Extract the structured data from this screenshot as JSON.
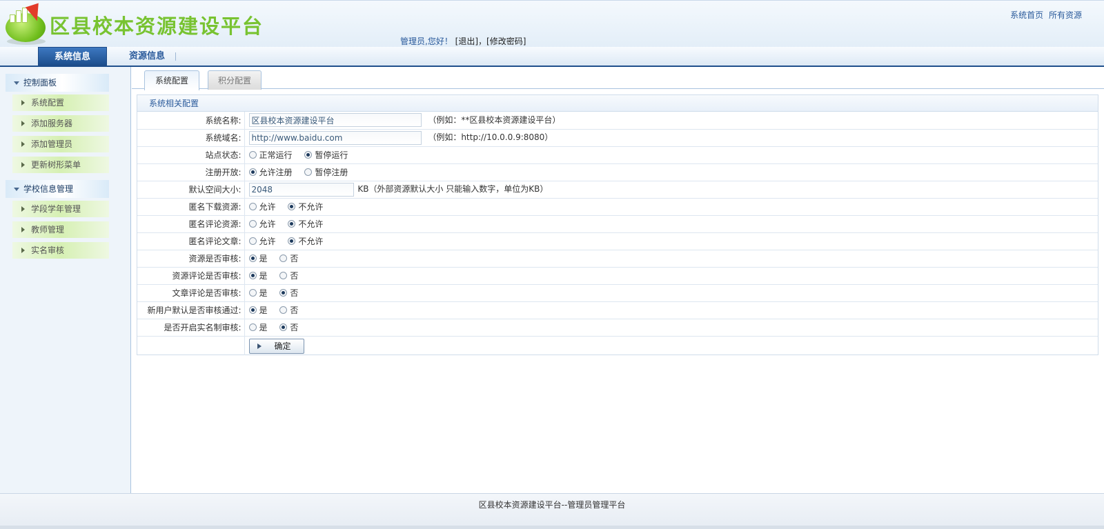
{
  "header": {
    "site_title": "区县校本资源建设平台",
    "welcome_prefix": "管理员,您好！",
    "logout": "[退出]",
    "separator": "，",
    "change_password": "[修改密码]",
    "top_links": [
      "系统首页",
      "所有资源"
    ]
  },
  "nav": {
    "tabs": [
      {
        "label": "系统信息",
        "active": true
      },
      {
        "label": "资源信息",
        "active": false
      }
    ]
  },
  "sidebar": {
    "groups": [
      {
        "title": "控制面板",
        "items": [
          "系统配置",
          "添加服务器",
          "添加管理员",
          "更新树形菜单"
        ]
      },
      {
        "title": "学校信息管理",
        "items": [
          "学段学年管理",
          "教师管理",
          "实名审核"
        ]
      }
    ]
  },
  "main": {
    "tabs": [
      {
        "label": "系统配置",
        "active": true
      },
      {
        "label": "积分配置",
        "active": false
      }
    ],
    "panel_title": "系统相关配置",
    "fields": {
      "system_name": {
        "label": "系统名称:",
        "value": "区县校本资源建设平台",
        "hint": "（例如：**区县校本资源建设平台）"
      },
      "system_domain": {
        "label": "系统域名:",
        "value": "http://www.baidu.com",
        "hint": "（例如：http://10.0.0.9:8080）"
      },
      "site_status": {
        "label": "站点状态:",
        "options": [
          "正常运行",
          "暂停运行"
        ],
        "selected": 1
      },
      "registration": {
        "label": "注册开放:",
        "options": [
          "允许注册",
          "暂停注册"
        ],
        "selected": 0
      },
      "default_space": {
        "label": "默认空间大小:",
        "value": "2048",
        "hint": "KB（外部资源默认大小 只能输入数字，单位为KB）"
      },
      "anon_download": {
        "label": "匿名下载资源:",
        "options": [
          "允许",
          "不允许"
        ],
        "selected": 1
      },
      "anon_comment_resource": {
        "label": "匿名评论资源:",
        "options": [
          "允许",
          "不允许"
        ],
        "selected": 1
      },
      "anon_comment_article": {
        "label": "匿名评论文章:",
        "options": [
          "允许",
          "不允许"
        ],
        "selected": 1
      },
      "resource_review": {
        "label": "资源是否审核:",
        "options": [
          "是",
          "否"
        ],
        "selected": 0
      },
      "resource_comment_review": {
        "label": "资源评论是否审核:",
        "options": [
          "是",
          "否"
        ],
        "selected": 0
      },
      "article_comment_review": {
        "label": "文章评论是否审核:",
        "options": [
          "是",
          "否"
        ],
        "selected": 1
      },
      "new_user_default_approved": {
        "label": "新用户默认是否审核通过:",
        "options": [
          "是",
          "否"
        ],
        "selected": 0
      },
      "realname_review": {
        "label": "是否开启实名制审核:",
        "options": [
          "是",
          "否"
        ],
        "selected": 1
      }
    },
    "submit_label": "确定"
  },
  "footer": {
    "text": "区县校本资源建设平台--管理员管理平台"
  }
}
